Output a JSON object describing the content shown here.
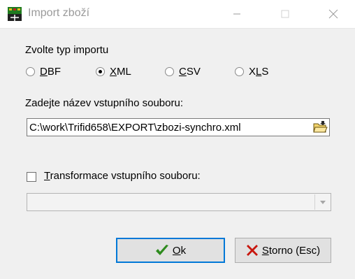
{
  "window": {
    "title": "Import zboží",
    "icon": "app-icon",
    "controls": {
      "minimize": "minimize-icon",
      "maximize": "maximize-icon",
      "close": "close-icon"
    }
  },
  "import_type": {
    "heading": "Zvolte typ importu",
    "options": [
      {
        "key": "D",
        "rest": "BF",
        "selected": false
      },
      {
        "key": "X",
        "rest": "ML",
        "selected": true
      },
      {
        "key": "C",
        "rest": "SV",
        "selected": false
      },
      {
        "prefix": "X",
        "key": "L",
        "rest": "S",
        "selected": false
      }
    ]
  },
  "input_file": {
    "heading": "Zadejte název vstupního souboru:",
    "value": "C:\\work\\Trifid658\\EXPORT\\zbozi-synchro.xml",
    "browse_icon": "open-folder-icon"
  },
  "transform": {
    "checked": false,
    "key": "T",
    "rest": "ransformace vstupního souboru:",
    "combo_value": ""
  },
  "buttons": {
    "ok": {
      "key": "O",
      "rest": "k",
      "icon": "checkmark-icon"
    },
    "cancel": {
      "key": "S",
      "rest": "torno (Esc)",
      "icon": "cross-icon"
    }
  },
  "colors": {
    "accent": "#0078d7",
    "ok_icon": "#2e8b1e",
    "cancel_icon": "#c8170e"
  }
}
